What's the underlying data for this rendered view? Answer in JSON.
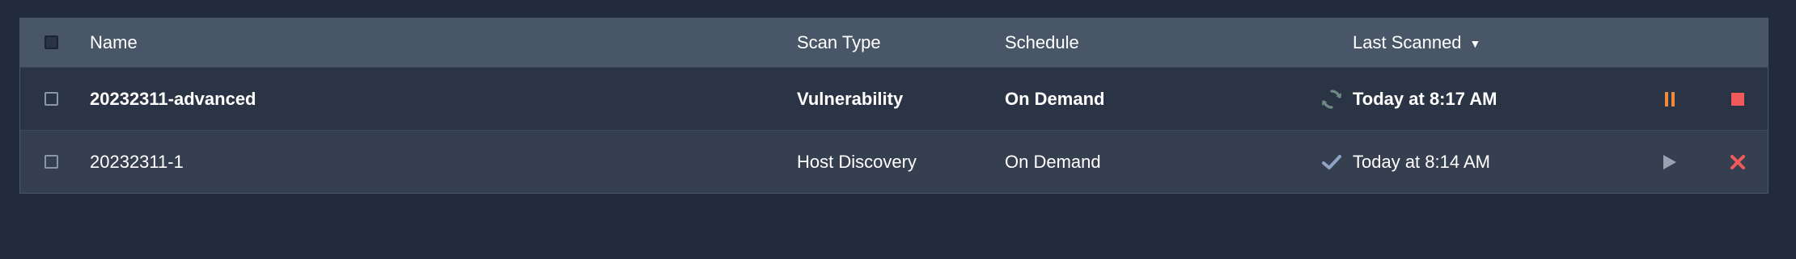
{
  "header": {
    "name": "Name",
    "scan_type": "Scan Type",
    "schedule": "Schedule",
    "last_scanned": "Last Scanned",
    "sort_indicator": "▼"
  },
  "rows": [
    {
      "name": "20232311-advanced",
      "scan_type": "Vulnerability",
      "schedule": "On Demand",
      "status_icon": "running-refresh-icon",
      "last_scanned": "Today at 8:17 AM",
      "actions": [
        "pause-icon",
        "stop-icon"
      ]
    },
    {
      "name": "20232311-1",
      "scan_type": "Host Discovery",
      "schedule": "On Demand",
      "status_icon": "completed-check-icon",
      "last_scanned": "Today at 8:14 AM",
      "actions": [
        "play-icon",
        "delete-x-icon"
      ]
    }
  ],
  "colors": {
    "background": "#222b3b",
    "header_bg": "#495667",
    "row_running_bg": "#2b3444",
    "row_done_bg": "#363f4f",
    "pause": "#f0883e",
    "stop": "#f05a5a",
    "play": "#98a2b0",
    "delete": "#f05a5a",
    "check": "#8fa3c5",
    "refresh": "#6f8a84"
  }
}
